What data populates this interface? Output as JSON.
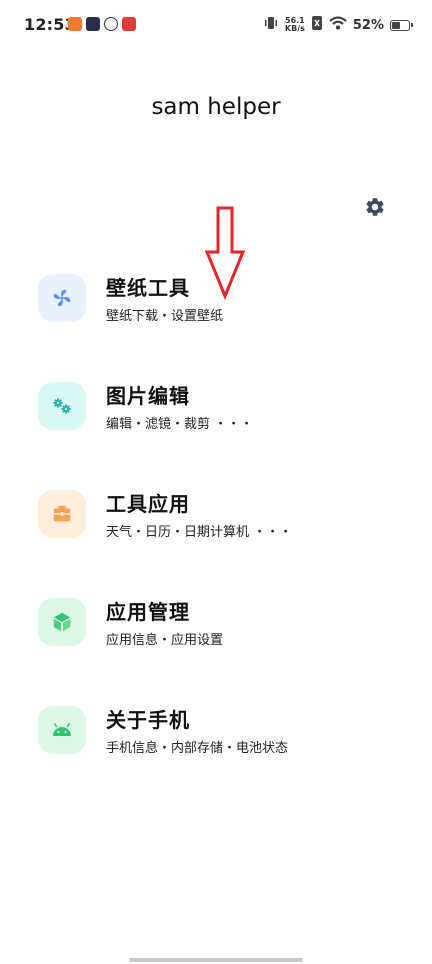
{
  "status_bar": {
    "time": "12:53",
    "net_speed_value": "56.1",
    "net_speed_unit": "KB/s",
    "battery_percent": "52%",
    "battery_level": 0.52
  },
  "app": {
    "title": "sam helper"
  },
  "menu": {
    "items": [
      {
        "title": "壁纸工具",
        "subtitle": "壁纸下载・设置壁纸",
        "icon": "fan-icon",
        "bg": "#e8f0fd",
        "fg": "#5b8ff2"
      },
      {
        "title": "图片编辑",
        "subtitle": "编辑・滤镜・裁剪 ・・・",
        "icon": "gears-icon",
        "bg": "#d9f7f3",
        "fg": "#1fb6a8"
      },
      {
        "title": "工具应用",
        "subtitle": "天气・日历・日期计算机 ・・・",
        "icon": "toolbox-icon",
        "bg": "#fdeedb",
        "fg": "#f4a352"
      },
      {
        "title": "应用管理",
        "subtitle": "应用信息・应用设置",
        "icon": "cube-icon",
        "bg": "#dcf7e6",
        "fg": "#33c471"
      },
      {
        "title": "关于手机",
        "subtitle": "手机信息・内部存储・电池状态",
        "icon": "android-icon",
        "bg": "#dcf7e6",
        "fg": "#33c471"
      }
    ]
  }
}
